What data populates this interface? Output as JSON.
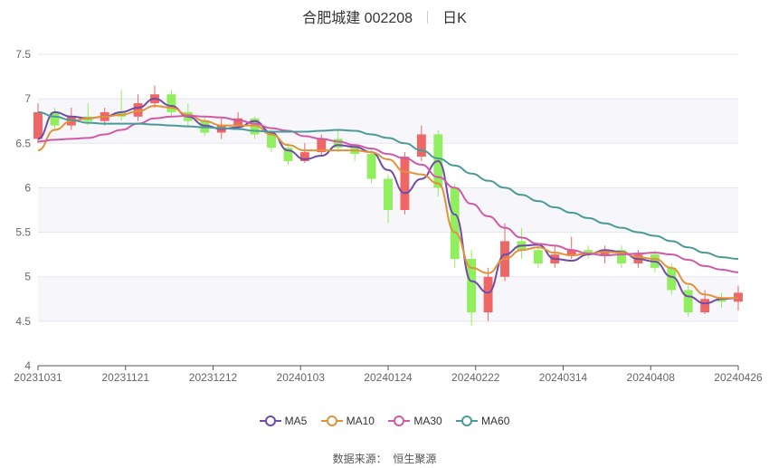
{
  "header": {
    "stock": "合肥城建 002208",
    "period": "日K"
  },
  "footer": {
    "source_label": "数据来源：",
    "source_name": "恒生聚源"
  },
  "colors": {
    "up": "#ee6666",
    "down": "#91ee5e",
    "ma5": "#6f4ca8",
    "ma10": "#e0933a",
    "ma30": "#d05aa8",
    "ma60": "#4a9a9a"
  },
  "chart_data": {
    "type": "candlestick",
    "ylim": [
      4,
      7.5
    ],
    "yticks": [
      "4",
      "4.5",
      "5",
      "5.5",
      "6",
      "6.5",
      "7",
      "7.5"
    ],
    "xticks": [
      "20231031",
      "20231121",
      "20231212",
      "20240103",
      "20240124",
      "20240222",
      "20240314",
      "20240408",
      "20240426"
    ],
    "grid": true,
    "legend": "bottom",
    "series": [
      {
        "name": "MA5",
        "color": "#6f4ca8",
        "values": [
          6.55,
          6.85,
          6.8,
          6.78,
          6.8,
          6.85,
          6.9,
          7.0,
          6.92,
          6.8,
          6.7,
          6.66,
          6.68,
          6.75,
          6.62,
          6.42,
          6.32,
          6.36,
          6.48,
          6.46,
          6.4,
          6.2,
          5.94,
          6.1,
          6.3,
          5.7,
          4.95,
          4.82,
          5.25,
          5.35,
          5.36,
          5.2,
          5.18,
          5.25,
          5.3,
          5.28,
          5.2,
          5.17,
          5.0,
          4.78,
          4.7,
          4.75,
          4.76
        ]
      },
      {
        "name": "MA10",
        "color": "#e0933a",
        "values": [
          6.42,
          6.65,
          6.75,
          6.78,
          6.8,
          6.82,
          6.86,
          6.92,
          6.9,
          6.82,
          6.75,
          6.7,
          6.7,
          6.7,
          6.6,
          6.48,
          6.42,
          6.42,
          6.42,
          6.42,
          6.4,
          6.32,
          6.18,
          6.15,
          6.05,
          5.5,
          5.1,
          5.04,
          5.2,
          5.3,
          5.33,
          5.27,
          5.24,
          5.26,
          5.28,
          5.27,
          5.22,
          5.2,
          5.1,
          4.92,
          4.8,
          4.76,
          4.76
        ]
      },
      {
        "name": "MA30",
        "color": "#d05aa8",
        "values": [
          6.52,
          6.54,
          6.55,
          6.56,
          6.6,
          6.65,
          6.72,
          6.78,
          6.8,
          6.81,
          6.8,
          6.79,
          6.76,
          6.72,
          6.67,
          6.64,
          6.58,
          6.55,
          6.52,
          6.48,
          6.44,
          6.38,
          6.33,
          6.26,
          6.12,
          6.0,
          5.82,
          5.68,
          5.55,
          5.44,
          5.37,
          5.35,
          5.3,
          5.26,
          5.24,
          5.25,
          5.26,
          5.27,
          5.25,
          5.19,
          5.12,
          5.08,
          5.05
        ]
      },
      {
        "name": "MA60",
        "color": "#4a9a9a",
        "values": [
          6.85,
          6.8,
          6.76,
          6.73,
          6.72,
          6.72,
          6.72,
          6.71,
          6.7,
          6.69,
          6.68,
          6.67,
          6.66,
          6.64,
          6.63,
          6.63,
          6.63,
          6.64,
          6.65,
          6.64,
          6.6,
          6.56,
          6.5,
          6.42,
          6.33,
          6.25,
          6.16,
          6.08,
          6.0,
          5.92,
          5.85,
          5.78,
          5.72,
          5.66,
          5.6,
          5.55,
          5.5,
          5.46,
          5.4,
          5.33,
          5.27,
          5.22,
          5.2
        ]
      }
    ],
    "candles": [
      [
        6.55,
        6.85,
        6.95,
        6.5
      ],
      [
        6.85,
        6.7,
        6.9,
        6.65
      ],
      [
        6.7,
        6.8,
        6.9,
        6.65
      ],
      [
        6.8,
        6.75,
        6.95,
        6.7
      ],
      [
        6.75,
        6.85,
        6.9,
        6.7
      ],
      [
        6.85,
        6.8,
        7.1,
        6.75
      ],
      [
        6.8,
        6.95,
        7.05,
        6.75
      ],
      [
        6.95,
        7.05,
        7.15,
        6.9
      ],
      [
        7.05,
        6.85,
        7.1,
        6.8
      ],
      [
        6.85,
        6.75,
        6.95,
        6.7
      ],
      [
        6.75,
        6.62,
        6.8,
        6.58
      ],
      [
        6.62,
        6.7,
        6.78,
        6.55
      ],
      [
        6.7,
        6.78,
        6.85,
        6.65
      ],
      [
        6.78,
        6.6,
        6.8,
        6.55
      ],
      [
        6.6,
        6.45,
        6.65,
        6.4
      ],
      [
        6.45,
        6.3,
        6.5,
        6.25
      ],
      [
        6.3,
        6.4,
        6.5,
        6.28
      ],
      [
        6.4,
        6.55,
        6.6,
        6.35
      ],
      [
        6.55,
        6.45,
        6.65,
        6.4
      ],
      [
        6.45,
        6.38,
        6.5,
        6.3
      ],
      [
        6.38,
        6.1,
        6.45,
        6.05
      ],
      [
        6.1,
        5.75,
        6.15,
        5.6
      ],
      [
        5.75,
        6.35,
        6.4,
        5.7
      ],
      [
        6.35,
        6.6,
        6.7,
        6.3
      ],
      [
        6.6,
        6.0,
        6.65,
        5.9
      ],
      [
        6.0,
        5.2,
        6.05,
        5.1
      ],
      [
        5.2,
        4.6,
        5.3,
        4.45
      ],
      [
        4.6,
        5.0,
        5.1,
        4.5
      ],
      [
        5.0,
        5.4,
        5.6,
        4.95
      ],
      [
        5.4,
        5.3,
        5.55,
        5.2
      ],
      [
        5.3,
        5.15,
        5.35,
        5.1
      ],
      [
        5.15,
        5.25,
        5.35,
        5.1
      ],
      [
        5.25,
        5.3,
        5.45,
        5.2
      ],
      [
        5.3,
        5.25,
        5.35,
        5.2
      ],
      [
        5.25,
        5.3,
        5.35,
        5.15
      ],
      [
        5.3,
        5.15,
        5.35,
        5.1
      ],
      [
        5.15,
        5.25,
        5.3,
        5.1
      ],
      [
        5.25,
        5.1,
        5.3,
        5.05
      ],
      [
        5.1,
        4.85,
        5.15,
        4.8
      ],
      [
        4.85,
        4.6,
        4.9,
        4.55
      ],
      [
        4.6,
        4.75,
        4.85,
        4.58
      ],
      [
        4.75,
        4.72,
        4.82,
        4.65
      ],
      [
        4.72,
        4.82,
        4.9,
        4.62
      ]
    ]
  }
}
